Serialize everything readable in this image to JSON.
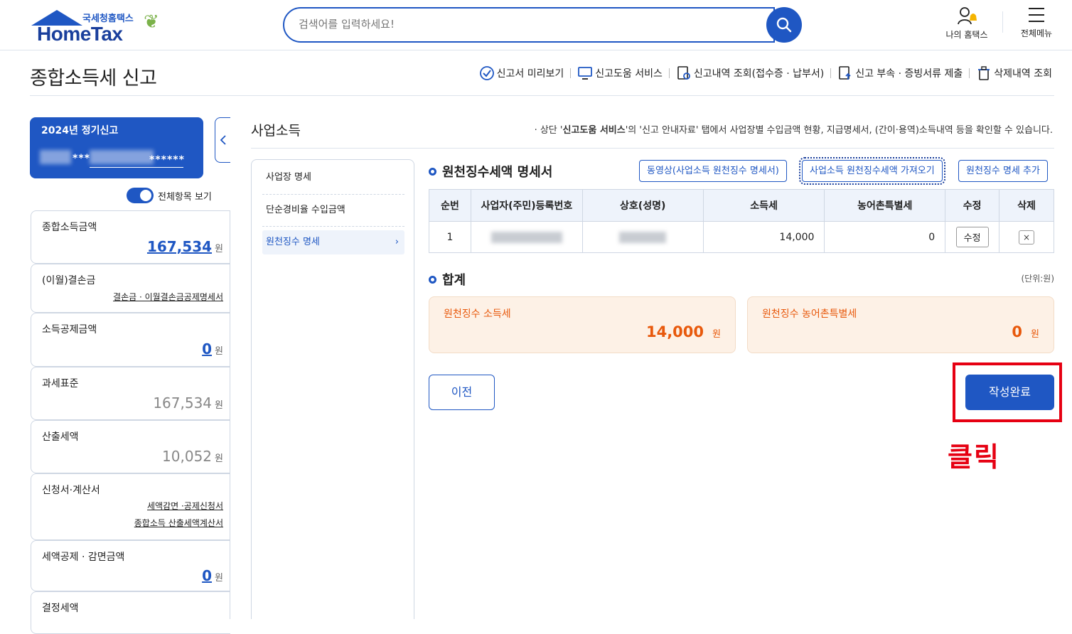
{
  "header": {
    "logo_sub": "국세청홈택스",
    "logo_main": "HomeTax",
    "search_placeholder": "검색어를 입력하세요!",
    "my_hometax": "나의 홈택스",
    "all_menu": "전체메뉴"
  },
  "page": {
    "title": "종합소득세 신고",
    "links": [
      "신고서 미리보기",
      "신고도움 서비스",
      "신고내역 조회(접수증 · 납부서)",
      "신고 부속 · 증빙서류 제출",
      "삭제내역 조회"
    ]
  },
  "sidebar": {
    "period": "2024년 정기신고",
    "masked_id": "***",
    "masked_number": "******",
    "toggle_label": "전체항목 보기",
    "items": [
      {
        "label": "종합소득금액",
        "value": "167,534",
        "unit": "원"
      },
      {
        "label": "(이월)결손금",
        "link1": "결손금 · 이월결손금공제명세서"
      },
      {
        "label": "소득공제금액",
        "value": "0",
        "unit": "원"
      },
      {
        "label": "과세표준",
        "value": "167,534",
        "unit": "원"
      },
      {
        "label": "산출세액",
        "value": "10,052",
        "unit": "원"
      },
      {
        "label": "신청서·계산서",
        "link1": "세액감면 ·공제신청서",
        "link2": "종합소득 산출세액계산서"
      },
      {
        "label": "세액공제 · 감면금액",
        "value": "0",
        "unit": "원"
      },
      {
        "label": "결정세액"
      }
    ]
  },
  "section": {
    "title": "사업소득",
    "note_prefix": "상단 '",
    "note_bold": "신고도움 서비스",
    "note_suffix": "'의 '신고 안내자료' 탭에서 사업장별 수입금액 현황, 지급명세서, (간이·용역)소득내역 등을 확인할 수 있습니다."
  },
  "subnav": [
    "사업장 명세",
    "단순경비율 수입금액",
    "원천징수 명세"
  ],
  "withholding": {
    "title": "원천징수세액 명세서",
    "buttons": [
      "동영상(사업소득 원천징수 명세서)",
      "사업소득 원천징수세액 가져오기",
      "원천징수 명세 추가"
    ],
    "columns": [
      "순번",
      "사업자(주민)등록번호",
      "상호(성명)",
      "소득세",
      "농어촌특별세",
      "수정",
      "삭제"
    ],
    "rows": [
      {
        "no": "1",
        "income_tax": "14,000",
        "rural_tax": "0",
        "edit": "수정",
        "delete": "×"
      }
    ]
  },
  "total": {
    "title": "합계",
    "unit_note": "(단위:원)",
    "income_label": "원천징수 소득세",
    "income_value": "14,000",
    "rural_label": "원천징수 농어촌특별세",
    "rural_value": "0",
    "unit": "원"
  },
  "actions": {
    "prev": "이전",
    "done": "작성완료",
    "annotation": "클릭"
  },
  "colors": {
    "primary": "#1f57c3",
    "accent_orange": "#e8590c",
    "highlight_red": "#e60012"
  }
}
